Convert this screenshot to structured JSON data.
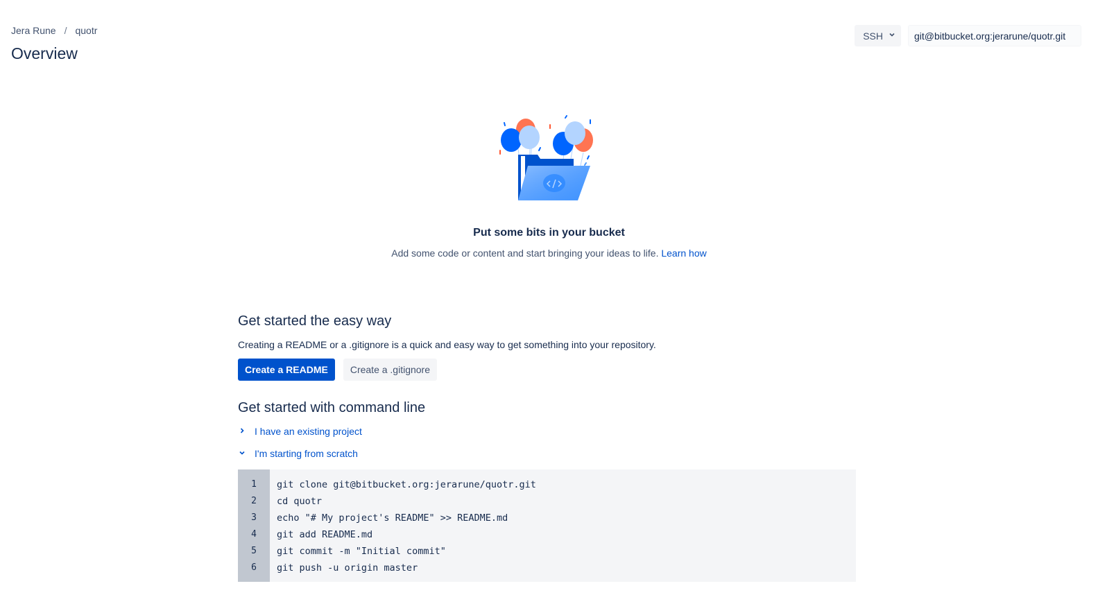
{
  "breadcrumb": {
    "owner": "Jera Rune",
    "separator": "/",
    "repo": "quotr"
  },
  "page": {
    "title": "Overview"
  },
  "clone": {
    "protocol": "SSH",
    "url": "git@bitbucket.org:jerarune/quotr.git"
  },
  "empty_state": {
    "illustration": "balloons-folder-illustration",
    "title": "Put some bits in your bucket",
    "description": "Add some code or content and start bringing your ideas to life.",
    "link": "Learn how"
  },
  "easy_way": {
    "title": "Get started the easy way",
    "description": "Creating a README or a .gitignore is a quick and easy way to get something into your repository.",
    "create_readme": "Create a README",
    "create_gitignore": "Create a .gitignore"
  },
  "command_line": {
    "title": "Get started with command line",
    "existing_project": "I have an existing project",
    "from_scratch": "I'm starting from scratch",
    "lines": [
      {
        "num": "1",
        "code": "git clone git@bitbucket.org:jerarune/quotr.git"
      },
      {
        "num": "2",
        "code": "cd quotr"
      },
      {
        "num": "3",
        "code": "echo \"# My project's README\" >> README.md"
      },
      {
        "num": "4",
        "code": "git add README.md"
      },
      {
        "num": "5",
        "code": "git commit -m \"Initial commit\""
      },
      {
        "num": "6",
        "code": "git push -u origin master"
      }
    ]
  },
  "colors": {
    "primary": "#0052CC",
    "text": "#172B4D",
    "subtle": "#42526E",
    "code_bg": "#F4F5F7",
    "gutter_bg": "#C1C7D0"
  }
}
